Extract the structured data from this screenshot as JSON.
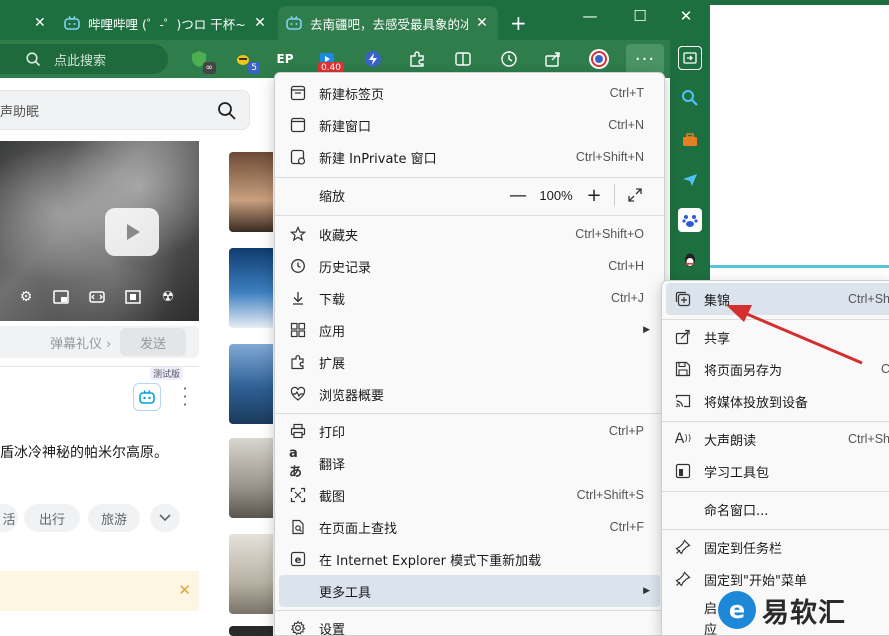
{
  "tabs": [
    {
      "title": "",
      "close": "✕"
    },
    {
      "title": "哔哩哔哩 (゜-゜)つロ 干杯~-bilibili",
      "close": "✕"
    },
    {
      "title": "去南疆吧，去感受最具象的冰川美景",
      "close": "✕"
    }
  ],
  "new_tab": "+",
  "window_controls": {
    "minimize": "—",
    "maximize": "☐",
    "close": "✕"
  },
  "toolbar": {
    "search_placeholder": "点此搜索",
    "badges": {
      "ext2": "5",
      "ext_red": "0.40",
      "ext1": "∞"
    },
    "more": "···"
  },
  "web": {
    "search_text": "声助眠",
    "danmu_etiquette": "弹幕礼仪 ›",
    "send": "发送",
    "beta": "测试版",
    "desc": "盾冰冷神秘的帕米尔高原。",
    "tags": [
      "活",
      "出行",
      "旅游"
    ],
    "notice_close": "✕"
  },
  "menu": {
    "items": [
      {
        "label": "新建标签页",
        "shortcut": "Ctrl+T",
        "icon": "new-tab-icon"
      },
      {
        "label": "新建窗口",
        "shortcut": "Ctrl+N",
        "icon": "new-window-icon"
      },
      {
        "label": "新建 InPrivate 窗口",
        "shortcut": "Ctrl+Shift+N",
        "icon": "inprivate-icon"
      },
      {
        "label": "缩放",
        "shortcut": "",
        "icon": ""
      },
      {
        "label": "收藏夹",
        "shortcut": "Ctrl+Shift+O",
        "icon": "favorites-icon"
      },
      {
        "label": "历史记录",
        "shortcut": "Ctrl+H",
        "icon": "history-icon"
      },
      {
        "label": "下载",
        "shortcut": "Ctrl+J",
        "icon": "download-icon"
      },
      {
        "label": "应用",
        "shortcut": "",
        "icon": "apps-icon"
      },
      {
        "label": "扩展",
        "shortcut": "",
        "icon": "extensions-icon"
      },
      {
        "label": "浏览器概要",
        "shortcut": "",
        "icon": "browser-essentials-icon"
      },
      {
        "label": "打印",
        "shortcut": "Ctrl+P",
        "icon": "print-icon"
      },
      {
        "label": "翻译",
        "shortcut": "",
        "icon": "translate-icon"
      },
      {
        "label": "截图",
        "shortcut": "Ctrl+Shift+S",
        "icon": "screenshot-icon"
      },
      {
        "label": "在页面上查找",
        "shortcut": "Ctrl+F",
        "icon": "find-icon"
      },
      {
        "label": "在 Internet Explorer 模式下重新加载",
        "shortcut": "",
        "icon": "ie-icon"
      },
      {
        "label": "更多工具",
        "shortcut": "",
        "icon": ""
      },
      {
        "label": "设置",
        "shortcut": "",
        "icon": "settings-icon"
      }
    ],
    "zoom": {
      "minus": "—",
      "value": "100%",
      "plus": "+"
    }
  },
  "submenu": {
    "items": [
      {
        "label": "集锦",
        "shortcut": "Ctrl+Sh"
      },
      {
        "label": "共享",
        "shortcut": ""
      },
      {
        "label": "将页面另存为",
        "shortcut": "C"
      },
      {
        "label": "将媒体投放到设备",
        "shortcut": ""
      },
      {
        "label": "大声朗读",
        "shortcut": "Ctrl+Sh"
      },
      {
        "label": "学习工具包",
        "shortcut": ""
      },
      {
        "label": "命名窗口...",
        "shortcut": ""
      },
      {
        "label": "固定到任务栏",
        "shortcut": ""
      },
      {
        "label": "固定到\"开始\"菜单",
        "shortcut": ""
      },
      {
        "label": "启",
        "shortcut": ""
      },
      {
        "label": "应",
        "shortcut": ""
      }
    ]
  },
  "watermark": {
    "brand": "易软汇",
    "logo_letter": "e"
  },
  "colors": {
    "tab_bg": "#1d6f3f",
    "toolbar_bg": "#2e7d4b",
    "menu_highlight": "#dbe3ec",
    "arrow": "#d32f2f"
  }
}
